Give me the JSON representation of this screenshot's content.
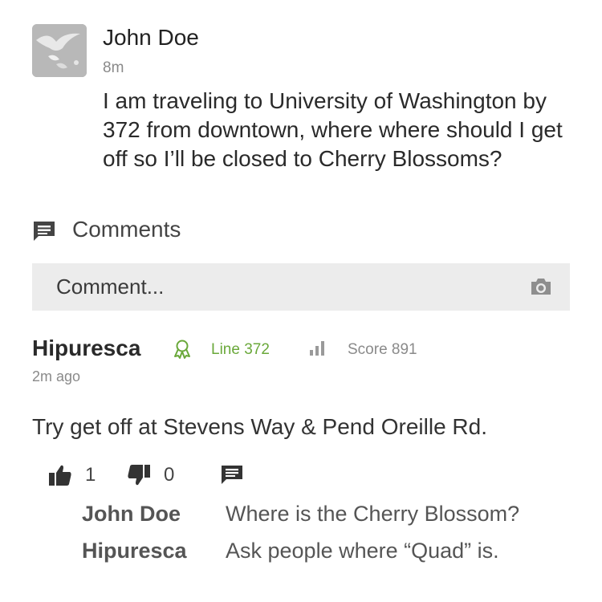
{
  "post": {
    "author": "John Doe",
    "time": "8m",
    "text": "I am traveling to University of Washington by 372 from downtown, where where should I get off so I’ll be closed to Cherry Blossoms?"
  },
  "comments_section": {
    "label": "Comments",
    "input_placeholder": "Comment...",
    "icon": "comment-icon"
  },
  "reply": {
    "author": "Hipuresca",
    "line_label": "Line 372",
    "score_label": "Score 891",
    "time": "2m ago",
    "text": "Try get off at Stevens Way & Pend Oreille Rd.",
    "likes": "1",
    "dislikes": "0",
    "accent_color": "#6aa83a",
    "sub_comments": [
      {
        "name": "John Doe",
        "text": "Where is the Cherry Blossom?"
      },
      {
        "name": "Hipuresca",
        "text": "Ask people where “Quad” is."
      }
    ]
  }
}
